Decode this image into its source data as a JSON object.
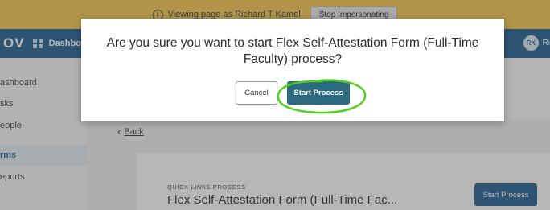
{
  "banner": {
    "text": "Viewing page as Richard T Kamel",
    "stop_label": "Stop Impersonating"
  },
  "topnav": {
    "brand": "OV",
    "dashboard_label": "Dashbo",
    "avatar_initials": "RK",
    "avatar_name": "Ri"
  },
  "sidebar": {
    "items": [
      {
        "label": "ashboard"
      },
      {
        "label": "sks"
      },
      {
        "label": "eople"
      },
      {
        "label": "rms"
      },
      {
        "label": "eports"
      }
    ]
  },
  "main": {
    "back_label": "Back",
    "card": {
      "kicker": "QUICK LINKS PROCESS",
      "title": "Flex Self-Attestation Form (Full-Time Fac...",
      "button_label": "Start Process"
    }
  },
  "modal": {
    "question": "Are you sure you want to start Flex Self-Attestation Form (Full-Time Faculty) process?",
    "cancel_label": "Cancel",
    "start_label": "Start Process"
  },
  "colors": {
    "banner": "#f3c44a",
    "nav": "#1d5c8e",
    "primary_button": "#2c6a80",
    "annotation": "#4fd11f"
  }
}
